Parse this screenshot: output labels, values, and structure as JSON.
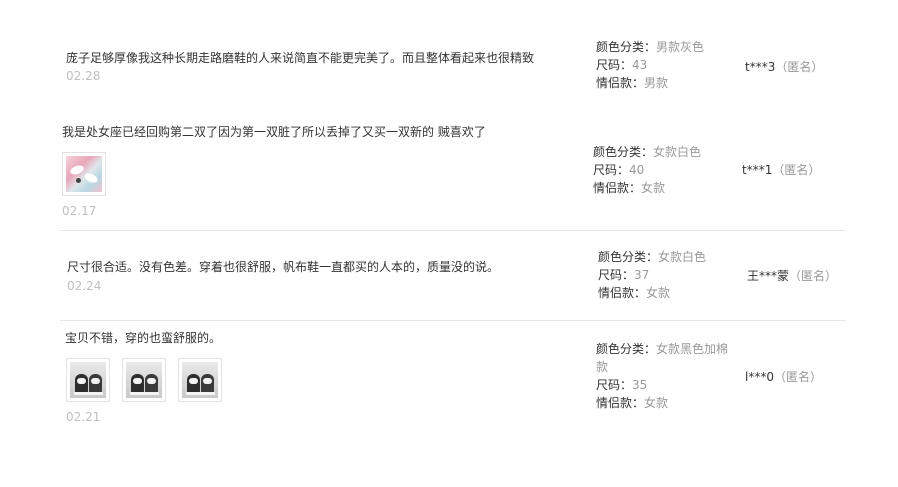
{
  "reviews": [
    {
      "content": "庞子足够厚像我这种长期走路磨鞋的人来说简直不能更完美了。而且整体看起来也很精致",
      "date": "02.28",
      "photos": [],
      "sku": {
        "color_label": "颜色分类：",
        "color_value": "男款灰色",
        "size_label": "尺码：",
        "size_value": "43",
        "couple_label": "情侣款：",
        "couple_value": "男款"
      },
      "user": {
        "name": "t***3",
        "anon": "（匿名）"
      }
    },
    {
      "content": "我是处女座已经回购第二双了因为第一双脏了所以丢掉了又买一双新的 贼喜欢了",
      "date": "02.17",
      "photos": [
        "pink-shoes-photo"
      ],
      "sku": {
        "color_label": "颜色分类：",
        "color_value": "女款白色",
        "size_label": "尺码：",
        "size_value": "40",
        "couple_label": "情侣款：",
        "couple_value": "女款"
      },
      "user": {
        "name": "t***1",
        "anon": "（匿名）"
      }
    },
    {
      "content": "尺寸很合适。没有色差。穿着也很舒服，帆布鞋一直都买的人本的，质量没的说。",
      "date": "02.24",
      "photos": [],
      "sku": {
        "color_label": "颜色分类：",
        "color_value": "女款白色",
        "size_label": "尺码：",
        "size_value": "37",
        "couple_label": "情侣款：",
        "couple_value": "女款"
      },
      "user": {
        "name": "王***蒙",
        "anon": "（匿名）"
      }
    },
    {
      "content": "宝贝不错，穿的也蛮舒服的。",
      "date": "02.21",
      "photos": [
        "black-shoes-photo-1",
        "black-shoes-photo-2",
        "black-shoes-photo-3"
      ],
      "sku": {
        "color_label": "颜色分类：",
        "color_value": "女款黑色加棉",
        "color_value_cont": "款",
        "size_label": "尺码：",
        "size_value": "35",
        "couple_label": "情侣款：",
        "couple_value": "女款"
      },
      "user": {
        "name": "l***0",
        "anon": "（匿名）"
      }
    }
  ],
  "colors": {
    "text": "#333333",
    "muted": "#999999",
    "date": "#c0c0c0",
    "divider": "#e6e6e6"
  }
}
